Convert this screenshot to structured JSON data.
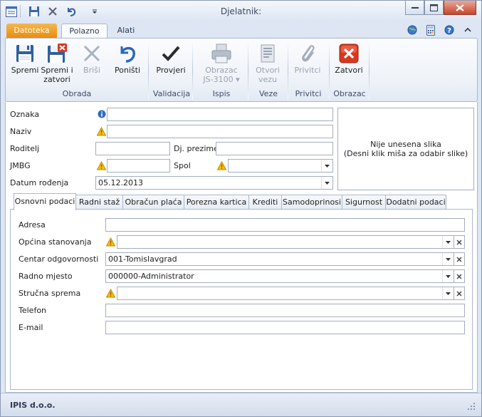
{
  "window": {
    "title": "Djelatnik:",
    "buttons": [
      "minimize",
      "restore",
      "close"
    ]
  },
  "qat": {
    "icons": [
      "app-menu-icon",
      "save-icon",
      "delete-icon",
      "undo-icon",
      "customize-qat-icon"
    ]
  },
  "ribbon_tabs": [
    {
      "label": "Datoteka"
    },
    {
      "label": "Polazno"
    },
    {
      "label": "Alati"
    }
  ],
  "ribbon": {
    "buttons": [
      {
        "label": "Spremi",
        "label2": "",
        "icon": "save-icon",
        "disabled": false
      },
      {
        "label": "Spremi i",
        "label2": "zatvori",
        "icon": "save-close-icon",
        "disabled": false
      },
      {
        "label": "Briši",
        "label2": "",
        "icon": "delete-icon",
        "disabled": true
      },
      {
        "label": "Poništi",
        "label2": "",
        "icon": "undo-icon",
        "disabled": false
      },
      {
        "label": "Provjeri",
        "label2": "",
        "icon": "check-icon",
        "disabled": false
      },
      {
        "label": "Obrazac",
        "label2": "JS-3100 ▾",
        "icon": "printer-icon",
        "disabled": true
      },
      {
        "label": "Otvori",
        "label2": "vezu",
        "icon": "link-document-icon",
        "disabled": true
      },
      {
        "label": "Privitci",
        "label2": "",
        "icon": "paperclip-icon",
        "disabled": true
      },
      {
        "label": "Zatvori",
        "label2": "",
        "icon": "close-icon",
        "disabled": false
      }
    ],
    "groups": [
      {
        "label": "Obrada"
      },
      {
        "label": "Validacija"
      },
      {
        "label": "Ispis"
      },
      {
        "label": "Veze"
      },
      {
        "label": "Privitci"
      },
      {
        "label": "Obrazac"
      }
    ]
  },
  "header_form": {
    "oznaka_label": "Oznaka",
    "oznaka_value": "",
    "naziv_label": "Naziv",
    "naziv_value": "",
    "roditelj_label": "Roditelj",
    "roditelj_value": "",
    "dj_prezime_label": "Dj. prezime",
    "dj_prezime_value": "",
    "jmbg_label": "JMBG",
    "jmbg_value": "",
    "spol_label": "Spol",
    "spol_value": "",
    "datum_label": "Datum rođenja",
    "datum_value": "05.12.2013"
  },
  "image": {
    "line1": "Nije unesena slika",
    "line2": "(Desni klik miša za odabir slike)"
  },
  "tabs": [
    {
      "label": "Osnovni podaci"
    },
    {
      "label": "Radni staž"
    },
    {
      "label": "Obračun plaća"
    },
    {
      "label": "Porezna kartica"
    },
    {
      "label": "Krediti"
    },
    {
      "label": "Samodoprinosi"
    },
    {
      "label": "Sigurnost"
    },
    {
      "label": "Dodatni podaci"
    }
  ],
  "basic": {
    "adresa_label": "Adresa",
    "adresa_value": "",
    "opcina_label": "Općina stanovanja",
    "opcina_value": "",
    "centar_label": "Centar odgovornosti",
    "centar_value": "001-Tomislavgrad",
    "radno_label": "Radno mjesto",
    "radno_value": "000000-Administrator",
    "strucna_label": "Stručna sprema",
    "strucna_value": "",
    "telefon_label": "Telefon",
    "telefon_value": "",
    "email_label": "E-mail",
    "email_value": ""
  },
  "status": {
    "company": "IPIS d.o.o."
  },
  "colors": {
    "accent_orange": "#e88d12",
    "warning_yellow": "#f5c400",
    "close_red": "#d9381e",
    "info_blue": "#2f6cc3"
  }
}
